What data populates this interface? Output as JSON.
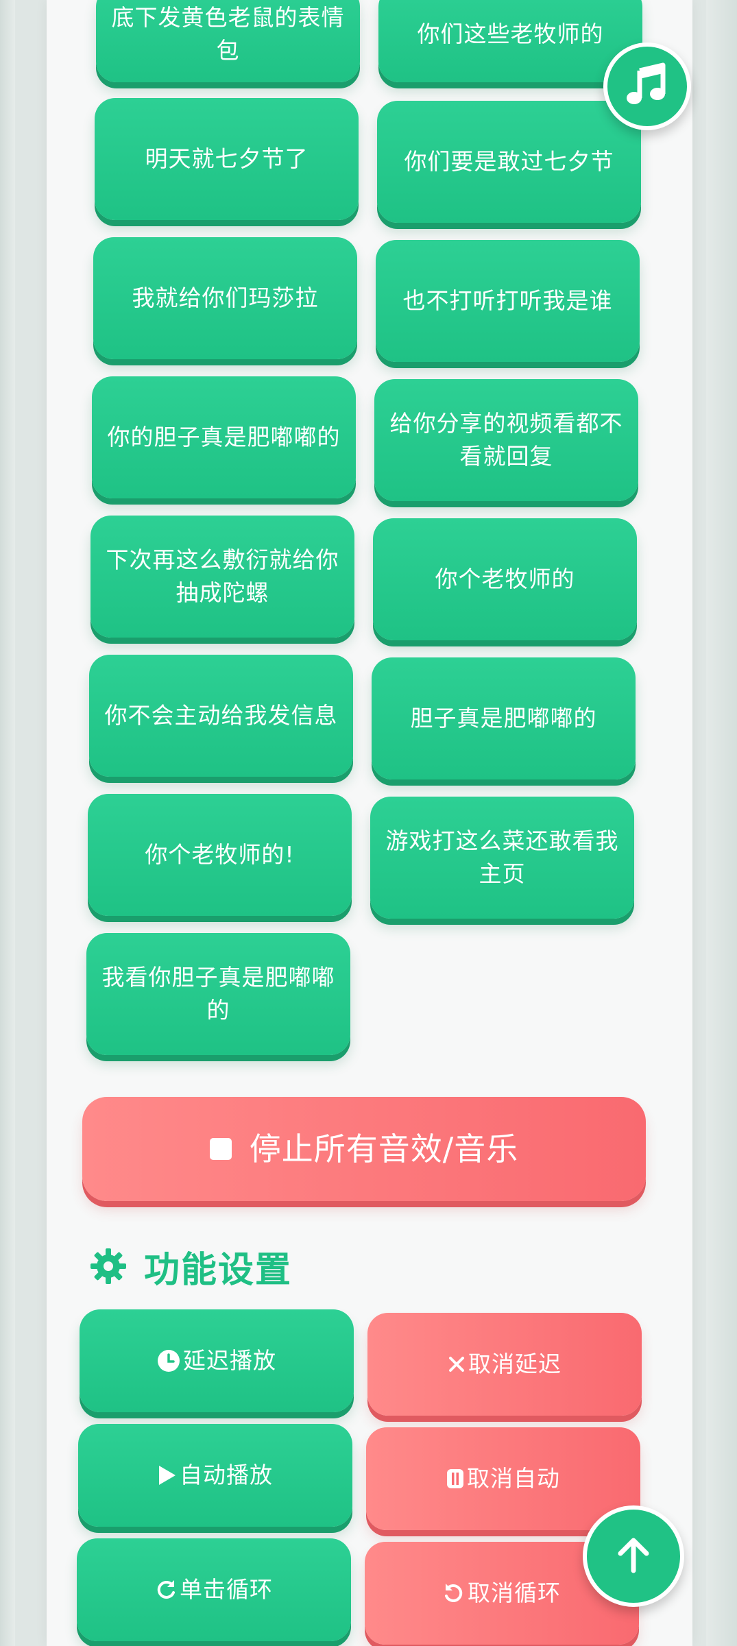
{
  "sound_buttons": [
    {
      "label": "底下发黄色老鼠的表情包"
    },
    {
      "label": "你们这些老牧师的"
    },
    {
      "label": "明天就七夕节了"
    },
    {
      "label": "你们要是敢过七夕节"
    },
    {
      "label": "我就给你们玛莎拉"
    },
    {
      "label": "也不打听打听我是谁"
    },
    {
      "label": "你的胆子真是肥嘟嘟的"
    },
    {
      "label": "给你分享的视频看都不看就回复"
    },
    {
      "label": "下次再这么敷衍就给你抽成陀螺"
    },
    {
      "label": "你个老牧师的"
    },
    {
      "label": "你不会主动给我发信息"
    },
    {
      "label": "胆子真是肥嘟嘟的"
    },
    {
      "label": "你个老牧师的!"
    },
    {
      "label": "游戏打这么菜还敢看我主页"
    },
    {
      "label": "我看你胆子真是肥嘟嘟的"
    }
  ],
  "stop_button": {
    "label": "停止所有音效/音乐",
    "icon": "stop-square-icon"
  },
  "settings": {
    "title": "功能设置",
    "icon": "gear-icon",
    "delay_play": {
      "label": "延迟播放",
      "icon": "clock-icon"
    },
    "cancel_delay": {
      "label": "取消延迟",
      "icon": "close-icon"
    },
    "auto_play": {
      "label": "自动播放",
      "icon": "play-icon"
    },
    "cancel_auto": {
      "label": "取消自动",
      "icon": "pause-icon"
    },
    "loop_click": {
      "label": "单击循环",
      "icon": "redo-icon"
    },
    "cancel_loop": {
      "label": "取消循环",
      "icon": "undo-icon"
    }
  },
  "floating": {
    "music_icon": "music-note-icon",
    "top_icon": "arrow-up-icon"
  },
  "colors": {
    "green": "#20c285",
    "red": "#f96a70",
    "section_title": "#1fbf84"
  }
}
